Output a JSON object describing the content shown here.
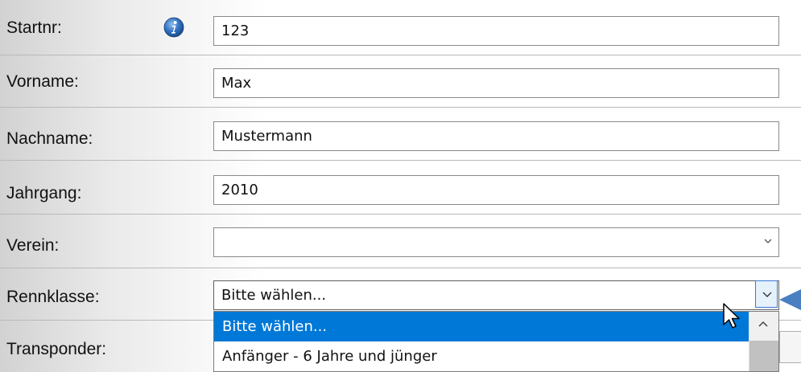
{
  "form": {
    "fields": [
      {
        "label": "Startnr:",
        "value": "123"
      },
      {
        "label": "Vorname:",
        "value": "Max"
      },
      {
        "label": "Nachname:",
        "value": "Mustermann"
      },
      {
        "label": "Jahrgang:",
        "value": "2010"
      },
      {
        "label": "Verein:",
        "value": ""
      },
      {
        "label": "Rennklasse:",
        "value": "Bitte wählen..."
      },
      {
        "label": "Transponder:"
      }
    ]
  },
  "dropdown": {
    "options": [
      "Bitte wählen...",
      "Anfänger - 6 Jahre und jünger"
    ],
    "selected_index": 0
  },
  "icons": {
    "info": "info-icon",
    "chevron": "chevron-down-icon",
    "cursor": "mouse-pointer-icon",
    "annotation": "left-arrow-marker-icon"
  },
  "colors": {
    "selected_option_bg": "#0078d7",
    "accent_arrow": "#4a7fc1"
  }
}
